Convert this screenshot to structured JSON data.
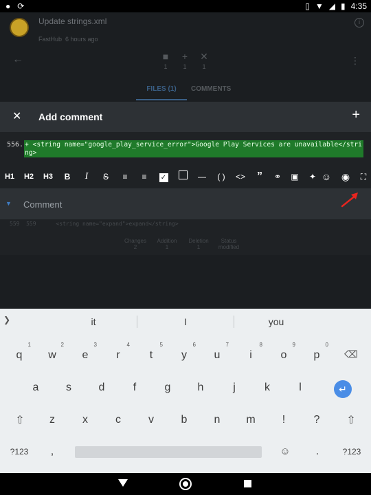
{
  "status_bar": {
    "time": "4:35"
  },
  "background": {
    "commit_title": "Update strings.xml",
    "author": "FastHub",
    "time_ago": "6 hours ago",
    "stats": [
      {
        "icon": "file-icon",
        "count": "1"
      },
      {
        "icon": "add-icon",
        "count": "1"
      },
      {
        "icon": "remove-icon",
        "count": "1"
      }
    ],
    "tabs": [
      "FILES (1)",
      "COMMENTS"
    ],
    "file_line": "559  559      <string name=\"expand\">expand</string>",
    "file_stats": [
      {
        "label": "Changes",
        "value": "2"
      },
      {
        "label": "Addition",
        "value": "1"
      },
      {
        "label": "Deletion",
        "value": "1"
      },
      {
        "label": "Status",
        "value": "modified"
      }
    ]
  },
  "dialog": {
    "title": "Add comment",
    "code_line_number": "556.",
    "code_text": "+ <string name=\"google_play_service_error\">Google Play Services are unavailable</string>",
    "comment_placeholder": "Comment"
  },
  "toolbar": {
    "h1": "H1",
    "h2": "H2",
    "h3": "H3"
  },
  "keyboard": {
    "suggestions": [
      "it",
      "I",
      "you"
    ],
    "row1": [
      "q",
      "w",
      "e",
      "r",
      "t",
      "y",
      "u",
      "i",
      "o",
      "p"
    ],
    "row1_hints": [
      "1",
      "2",
      "3",
      "4",
      "5",
      "6",
      "7",
      "8",
      "9",
      "0"
    ],
    "row2": [
      "a",
      "s",
      "d",
      "f",
      "g",
      "h",
      "j",
      "k",
      "l"
    ],
    "row3": [
      "z",
      "x",
      "c",
      "v",
      "b",
      "n",
      "m",
      "!",
      "?"
    ],
    "symbols_key": "?123",
    "comma_key": ",",
    "period_key": "."
  }
}
